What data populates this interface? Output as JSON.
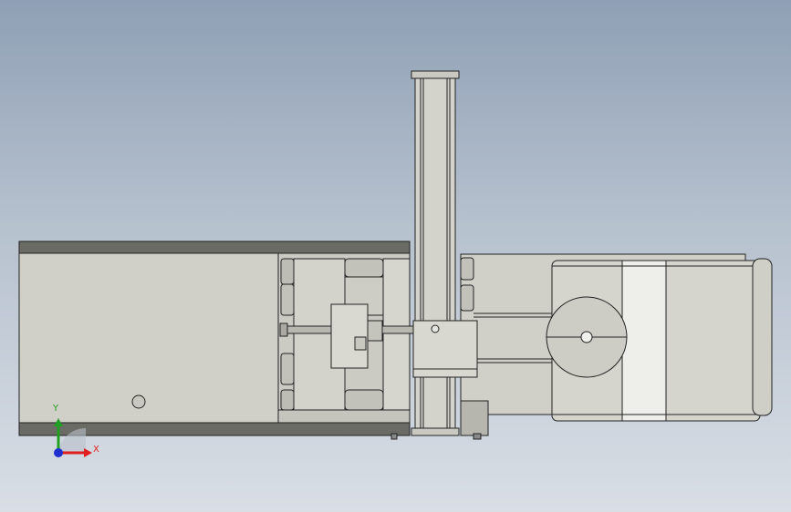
{
  "viewport": {
    "background_top": "#8fa0b5",
    "background_bottom": "#d9dee5"
  },
  "model": {
    "part_fill": "#cfcfc8",
    "part_stroke": "#222222",
    "highlight_fill": "#eeeeea",
    "dark_band": "#6b6b66"
  },
  "triad": {
    "x_label": "X",
    "y_label": "Y",
    "x_color": "#e02020",
    "y_color": "#20a020",
    "z_color": "#2030d0"
  }
}
